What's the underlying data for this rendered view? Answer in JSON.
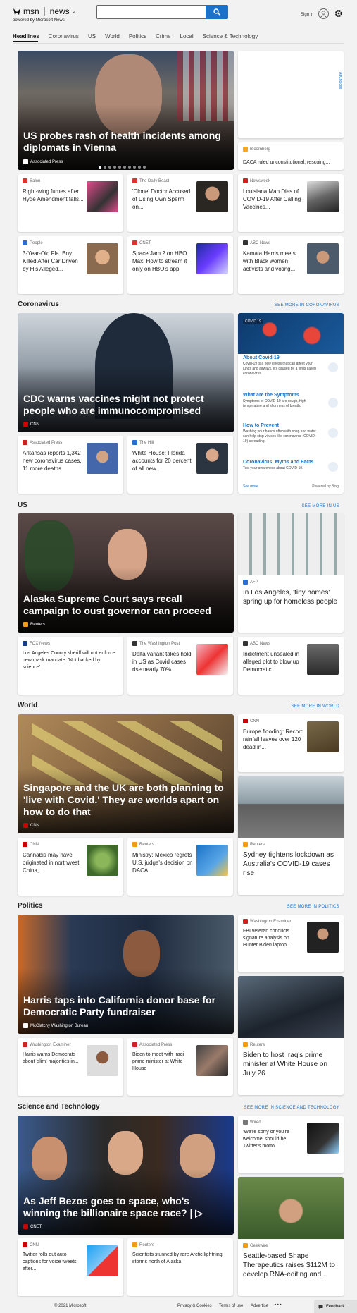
{
  "header": {
    "brand": "msn",
    "section": "news",
    "tagline": "powered by Microsoft News",
    "signin": "Sign in",
    "search_placeholder": ""
  },
  "nav": [
    "Headlines",
    "Coronavirus",
    "US",
    "World",
    "Politics",
    "Crime",
    "Local",
    "Science & Technology"
  ],
  "ad_label": "AdChoices",
  "top": {
    "hero": {
      "title": "US probes rash of health incidents among diplomats in Vienna",
      "source": "Associated Press"
    },
    "side": {
      "source": "Bloomberg",
      "title": "DACA ruled unconstitutional, rescuing..."
    },
    "row1": [
      {
        "source": "Salon",
        "title": "Right-wing fumes after Hyde Amendment falls..."
      },
      {
        "source": "The Daily Beast",
        "title": "'Clone' Doctor Accused of Using Own Sperm on..."
      },
      {
        "source": "Newsweek",
        "title": "Louisiana Man Dies of COVID-19 After Calling Vaccines..."
      }
    ],
    "row2": [
      {
        "source": "People",
        "title": "3-Year-Old Fla. Boy Killed After Car Driven by His Alleged..."
      },
      {
        "source": "CNET",
        "title": "Space Jam 2 on HBO Max: How to stream it only on HBO's app"
      },
      {
        "source": "ABC News",
        "title": "Kamala Harris meets with Black women activists and voting..."
      }
    ]
  },
  "coronavirus": {
    "heading": "Coronavirus",
    "see_more": "SEE MORE IN CORONAVIRUS",
    "hero": {
      "title": "CDC warns vaccines might not protect people who are immunocompromised",
      "source": "CNN"
    },
    "row": [
      {
        "source": "Associated Press",
        "title": "Arkansas reports 1,342 new coronavirus cases, 11 more deaths"
      },
      {
        "source": "The Hill",
        "title": "White House: Florida accounts for 20 percent of all new..."
      }
    ],
    "panel": {
      "badge": "COVID 19",
      "items": [
        {
          "title": "About Covid-19",
          "desc": "Covid-19 is a new illness that can affect your lungs and airways. It's caused by a virus called coronavirus."
        },
        {
          "title": "What are the Symptoms",
          "desc": "Symptoms of COVID-19 are cough, high temperature and shortness of breath."
        },
        {
          "title": "How to Prevent",
          "desc": "Washing your hands often with soap and water can help stop viruses like coronavirus (COVID-19) spreading."
        },
        {
          "title": "Coronavirus: Myths and Facts",
          "desc": "Test your awareness about COVID-19."
        }
      ],
      "see_more": "See more",
      "powered": "Powered by Bing"
    }
  },
  "us": {
    "heading": "US",
    "see_more": "SEE MORE IN US",
    "hero": {
      "title": "Alaska Supreme Court says recall campaign to oust governor can proceed",
      "source": "Reuters"
    },
    "side": {
      "source": "AFP",
      "title": "In Los Angeles, 'tiny homes' spring up for homeless people"
    },
    "row": [
      {
        "source": "FOX News",
        "title": "Los Angeles County sheriff will not enforce new mask mandate: 'Not backed by science'"
      },
      {
        "source": "The Washington Post",
        "title": "Delta variant takes hold in US as Covid cases rise nearly 70%"
      },
      {
        "source": "ABC News",
        "title": "Indictment unsealed in alleged plot to blow up Democratic..."
      }
    ]
  },
  "world": {
    "heading": "World",
    "see_more": "SEE MORE IN WORLD",
    "hero": {
      "title": "Singapore and the UK are both planning to 'live with Covid.' They are worlds apart on how to do that",
      "source": "CNN"
    },
    "side_top": {
      "source": "CNN",
      "title": "Europe flooding: Record rainfall leaves over 120 dead in..."
    },
    "side": {
      "source": "Reuters",
      "title": "Sydney tightens lockdown as Australia's COVID-19 cases rise"
    },
    "row": [
      {
        "source": "CNN",
        "title": "Cannabis may have originated in northwest China,..."
      },
      {
        "source": "Reuters",
        "title": "Ministry: Mexico regrets U.S. judge's decision on DACA"
      }
    ]
  },
  "politics": {
    "heading": "Politics",
    "see_more": "SEE MORE IN POLITICS",
    "hero": {
      "title": "Harris taps into California donor base for Democratic Party fundraiser",
      "source": "McClatchy Washington Bureau"
    },
    "side_top": {
      "source": "Washington Examiner",
      "title": "FBI veteran conducts signature analysis on Hunter Biden laptop..."
    },
    "side": {
      "source": "Reuters",
      "title": "Biden to host Iraq's prime minister at White House on July 26"
    },
    "row": [
      {
        "source": "Washington Examiner",
        "title": "Harris warns Democrats about 'slim' majorities in..."
      },
      {
        "source": "Associated Press",
        "title": "Biden to meet with Iraqi prime minister at White House"
      }
    ]
  },
  "scitech": {
    "heading": "Science and Technology",
    "see_more": "SEE MORE IN SCIENCE AND TECHNOLOGY",
    "hero": {
      "title": "As Jeff Bezos goes to space, who's winning the billionaire space race? | ▷",
      "source": "CNET"
    },
    "side_top": {
      "source": "Wired",
      "title": "'We're sorry or you're welcome' should be Twitter's motto"
    },
    "side": {
      "source": "Geekwire",
      "title": "Seattle-based Shape Therapeutics raises $112M to develop RNA-editing and..."
    },
    "row": [
      {
        "source": "CNN",
        "title": "Twitter rolls out auto captions for voice tweets after..."
      },
      {
        "source": "Reuters",
        "title": "Scientists stunned by rare Arctic lightning storms north of Alaska"
      }
    ]
  },
  "footer": {
    "copyright": "© 2021 Microsoft",
    "links": [
      "Privacy & Cookies",
      "Terms of use",
      "Advertise"
    ],
    "more": "• • •",
    "feedback": "Feedback"
  }
}
